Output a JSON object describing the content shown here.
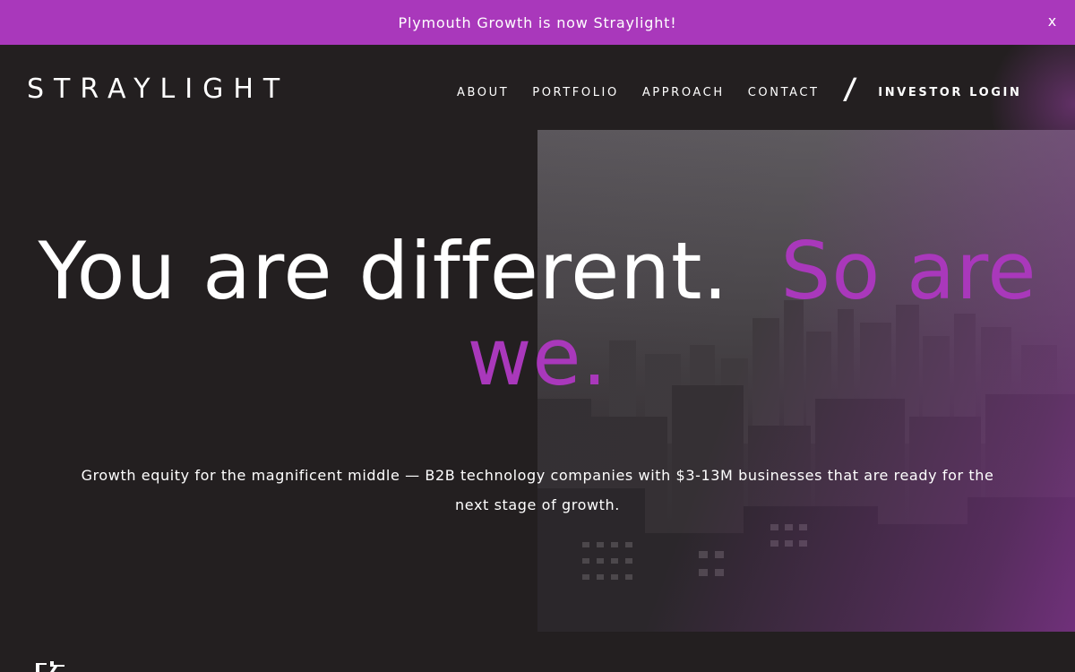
{
  "banner": {
    "text": "Plymouth Growth is now Straylight!",
    "close_label": "x"
  },
  "header": {
    "logo_text": "STRAYLIGHT",
    "nav": [
      "ABOUT",
      "PORTFOLIO",
      "APPROACH",
      "CONTACT"
    ],
    "separator": "/",
    "login_label": "INVESTOR LOGIN"
  },
  "hero": {
    "headline_part1": "You are different.",
    "headline_part2": "So are we.",
    "tagline": "Growth equity for the magnificent middle — B2B technology companies with $3-13M businesses that are ready for the next stage of growth.",
    "image_subject": "city-skyline-photo"
  },
  "colors": {
    "accent": "#a938bb",
    "background": "#231f20",
    "text": "#ffffff"
  }
}
